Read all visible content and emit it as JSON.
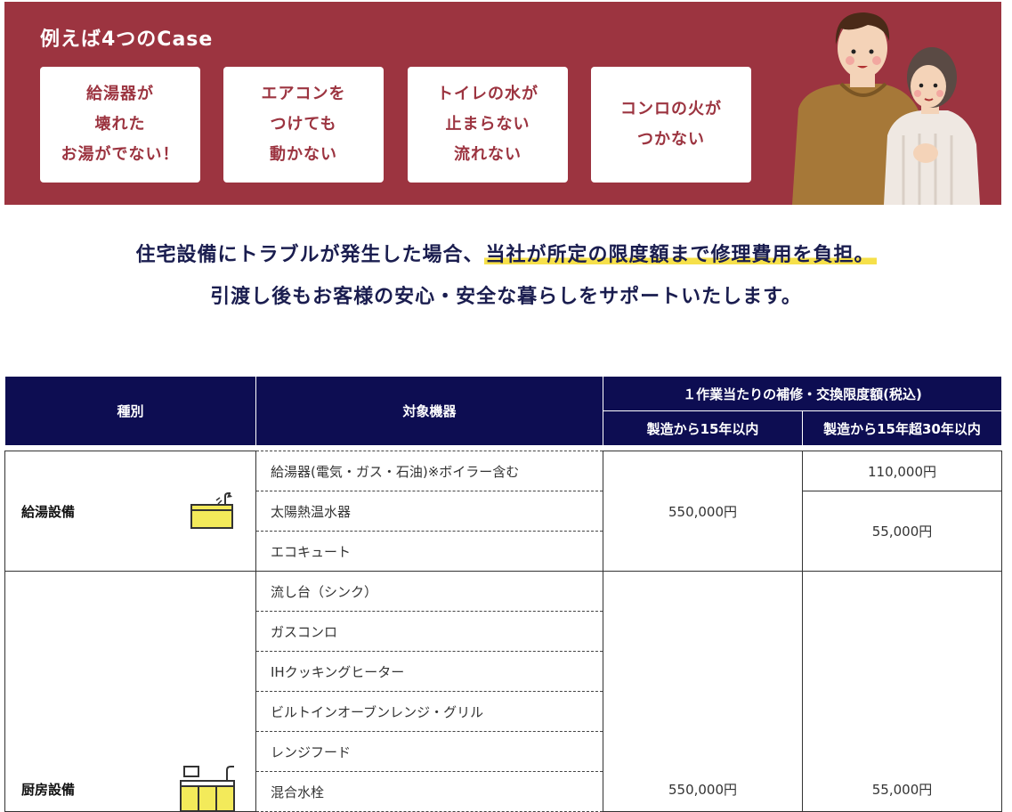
{
  "banner": {
    "title": "例えば4つのCase",
    "cases": [
      {
        "lines": [
          "給湯器が",
          "壊れた",
          "お湯がでない！"
        ]
      },
      {
        "lines": [
          "エアコンを",
          "つけても",
          "動かない"
        ]
      },
      {
        "lines": [
          "トイレの水が",
          "止まらない",
          "流れない"
        ]
      },
      {
        "lines": [
          "コンロの火が",
          "つかない"
        ]
      }
    ]
  },
  "message": {
    "line1_pre": "住宅設備にトラブルが発生した場合、",
    "line1_highlight": "当社が所定の限度額まで修理費用を負担。",
    "line2": "引渡し後もお客様の安心・安全な暮らしをサポートいたします。"
  },
  "table": {
    "headers": {
      "category": "種別",
      "device": "対象機器",
      "limit_group": "１作業当たりの補修・交換限度額(税込)",
      "within15": "製造から15年以内",
      "over15": "製造から15年超30年以内"
    },
    "hot_water": {
      "category": "給湯設備",
      "devices": [
        "給湯器(電気・ガス・石油)※ボイラー含む",
        "太陽熱温水器",
        "エコキュート"
      ],
      "price_within15": "550,000円",
      "price_over15_boiler": "110,000円",
      "price_over15_other": "55,000円"
    },
    "kitchen": {
      "category": "厨房設備",
      "devices": [
        "流し台（シンク）",
        "ガスコンロ",
        "IHクッキングヒーター",
        "ビルトインオーブンレンジ・グリル",
        "レンジフード",
        "混合水栓"
      ],
      "price_within15": "550,000円",
      "price_over15": "55,000円"
    }
  }
}
